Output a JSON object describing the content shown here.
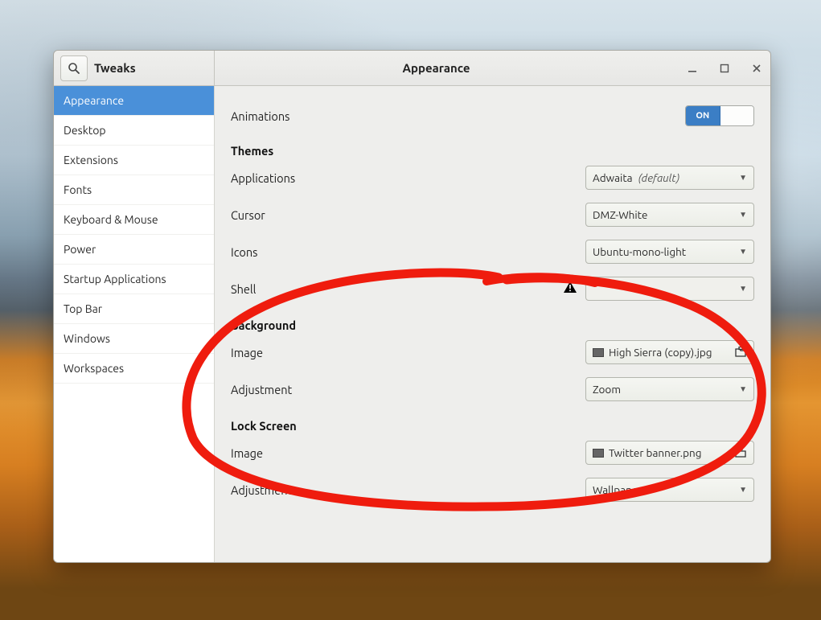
{
  "window": {
    "app_title": "Tweaks",
    "panel_title": "Appearance"
  },
  "sidebar": {
    "items": [
      {
        "label": "Appearance",
        "active": true
      },
      {
        "label": "Desktop"
      },
      {
        "label": "Extensions"
      },
      {
        "label": "Fonts"
      },
      {
        "label": "Keyboard & Mouse"
      },
      {
        "label": "Power"
      },
      {
        "label": "Startup Applications"
      },
      {
        "label": "Top Bar"
      },
      {
        "label": "Windows"
      },
      {
        "label": "Workspaces"
      }
    ]
  },
  "content": {
    "animations": {
      "label": "Animations",
      "toggle_on": "ON"
    },
    "themes": {
      "heading": "Themes",
      "applications": {
        "label": "Applications",
        "value": "Adwaita",
        "suffix": "(default)"
      },
      "cursor": {
        "label": "Cursor",
        "value": "DMZ-White"
      },
      "icons": {
        "label": "Icons",
        "value": "Ubuntu-mono-light"
      },
      "shell": {
        "label": "Shell",
        "value": ""
      }
    },
    "background": {
      "heading": "Background",
      "image": {
        "label": "Image",
        "file": "High Sierra (copy).jpg"
      },
      "adjustment": {
        "label": "Adjustment",
        "value": "Zoom"
      }
    },
    "lockscreen": {
      "heading": "Lock Screen",
      "image": {
        "label": "Image",
        "file": "Twitter banner.png"
      },
      "adjustment": {
        "label": "Adjustment",
        "value": "Wallpaper"
      }
    }
  }
}
